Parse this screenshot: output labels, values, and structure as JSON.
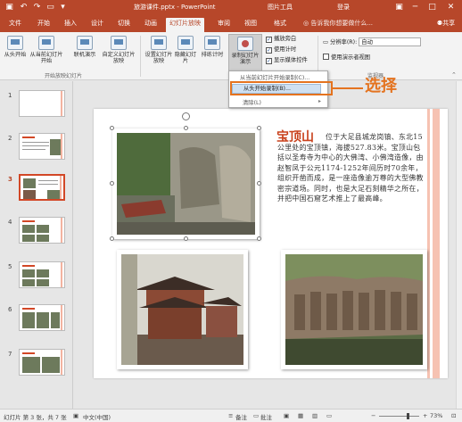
{
  "titlebar": {
    "doc_title": "旅游课件.pptx - PowerPoint",
    "tools_label": "图片工具",
    "login": "登录"
  },
  "tabs": [
    "文件",
    "开始",
    "插入",
    "设计",
    "切换",
    "动画",
    "幻灯片放映",
    "审阅",
    "视图",
    "格式"
  ],
  "active_tab": "幻灯片放映",
  "tell_me": "告诉我你想要做什么...",
  "share": "共享",
  "ribbon": {
    "from_start": "从头开始",
    "from_current": "从当前幻灯片开始",
    "online": "联机演示",
    "custom": "自定义幻灯片放映",
    "group_start": "开始放映幻灯片",
    "setup": "设置幻灯片放映",
    "hide": "隐藏幻灯片",
    "rehearse": "排练计时",
    "record": "录制幻灯片演示",
    "chk_narration": "播放旁白",
    "chk_timing": "使用计时",
    "chk_controls": "显示媒体控件",
    "resolution_label": "分辨率(R):",
    "resolution_value": "自动",
    "use_presenter": "使用演示者视图",
    "group_monitor": "监视器"
  },
  "dropdown": {
    "item_current": "从当前幻灯片开始录制(C)...",
    "item_start": "从头开始录制(B)...",
    "item_clear": "清除(L)"
  },
  "annotation": "选择",
  "thumbnails": [
    "1",
    "2",
    "3",
    "4",
    "5",
    "6",
    "7"
  ],
  "slide": {
    "title": "宝顶山",
    "body": "位于大足县城龙岗镇、东北15公里处的宝顶镇，海拔527.83米。宝顶山包括以圣寿寺为中心的大佛湾、小佛湾造像，由赵智凤于公元1174-1252年间历时70余年，组织开凿而成，是一座造像逾万尊的大型佛教密宗道场。同时，也是大足石刻精华之所在，并把中国石窟艺术推上了最高峰。"
  },
  "status": {
    "slide_info": "幻灯片 第 3 张，共 7 张",
    "language": "中文(中国)",
    "notes": "备注",
    "comments": "批注",
    "zoom": "73%"
  },
  "colors": {
    "brand": "#b7472a",
    "annotation": "#e4731f",
    "title_red": "#c9421d"
  }
}
